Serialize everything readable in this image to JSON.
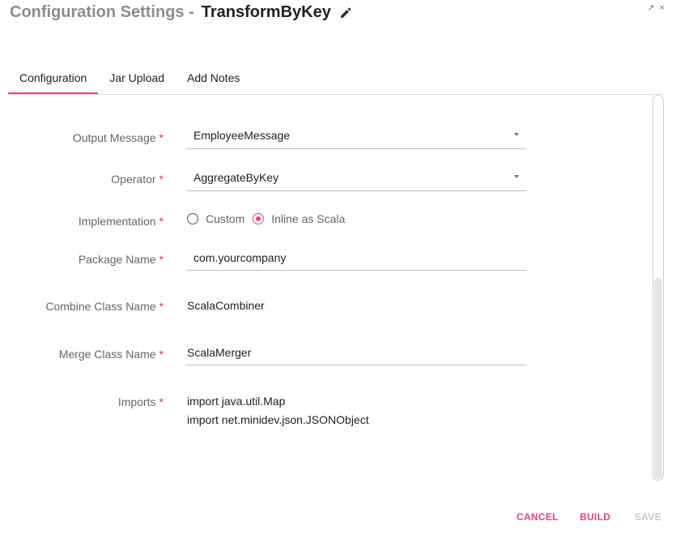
{
  "header": {
    "title_prefix": "Configuration Settings -",
    "title_name": "TransformByKey",
    "edit_icon": "pencil-icon"
  },
  "window_controls": {
    "expand_icon": "↗",
    "close_icon": "×"
  },
  "tabs": [
    {
      "label": "Configuration",
      "active": true
    },
    {
      "label": "Jar Upload",
      "active": false
    },
    {
      "label": "Add Notes",
      "active": false
    }
  ],
  "form": {
    "output_message": {
      "label": "Output Message",
      "value": "EmployeeMessage"
    },
    "operator": {
      "label": "Operator",
      "value": "AggregateByKey"
    },
    "implementation": {
      "label": "Implementation",
      "options": [
        {
          "label": "Custom",
          "selected": false
        },
        {
          "label": "Inline as Scala",
          "selected": true
        }
      ]
    },
    "package_name": {
      "label": "Package Name",
      "value": "com.yourcompany"
    },
    "combine_class_name": {
      "label": "Combine Class Name",
      "value": "ScalaCombiner"
    },
    "merge_class_name": {
      "label": "Merge Class Name",
      "value": "ScalaMerger"
    },
    "imports": {
      "label": "Imports",
      "lines": [
        "import java.util.Map",
        "import net.minidev.json.JSONObject"
      ]
    },
    "required_mark": "*"
  },
  "footer": {
    "cancel_label": "CANCEL",
    "build_label": "BUILD",
    "save_label": "SAVE"
  },
  "colors": {
    "accent": "#e0477b",
    "required": "#e0334a",
    "disabled": "#c8c8c8"
  }
}
